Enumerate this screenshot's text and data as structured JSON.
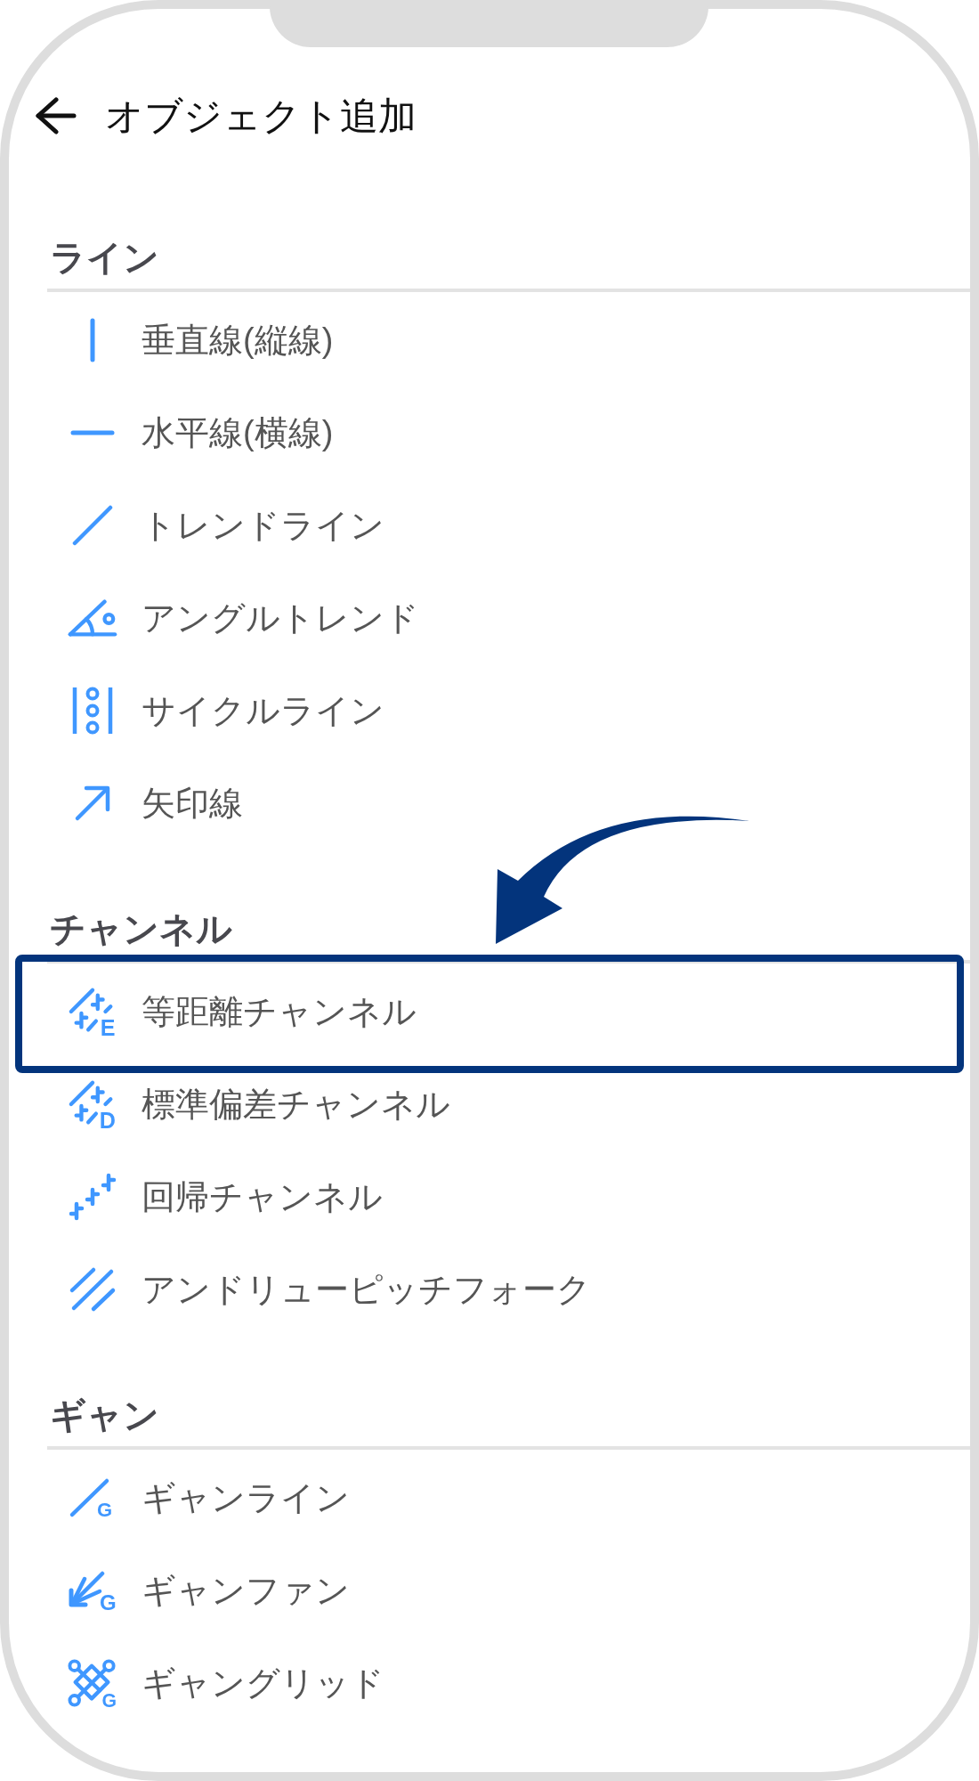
{
  "header": {
    "title": "オブジェクト追加"
  },
  "sections": [
    {
      "title": "ライン",
      "items": [
        {
          "label": "垂直線(縦線)",
          "highlighted": false
        },
        {
          "label": "水平線(横線)",
          "highlighted": false
        },
        {
          "label": "トレンドライン",
          "highlighted": false
        },
        {
          "label": "アングルトレンド",
          "highlighted": false
        },
        {
          "label": "サイクルライン",
          "highlighted": false
        },
        {
          "label": "矢印線",
          "highlighted": false
        }
      ]
    },
    {
      "title": "チャンネル",
      "items": [
        {
          "label": "等距離チャンネル",
          "icon_letter": "E",
          "highlighted": true
        },
        {
          "label": "標準偏差チャンネル",
          "icon_letter": "D",
          "highlighted": false
        },
        {
          "label": "回帰チャンネル",
          "highlighted": false
        },
        {
          "label": "アンドリューピッチフォーク",
          "highlighted": false
        }
      ]
    },
    {
      "title": "ギャン",
      "items": [
        {
          "label": "ギャンライン",
          "icon_letter": "G",
          "highlighted": false
        },
        {
          "label": "ギャンファン",
          "icon_letter": "G",
          "highlighted": false
        },
        {
          "label": "ギャングリッド",
          "icon_letter": "G",
          "highlighted": false
        }
      ]
    }
  ]
}
